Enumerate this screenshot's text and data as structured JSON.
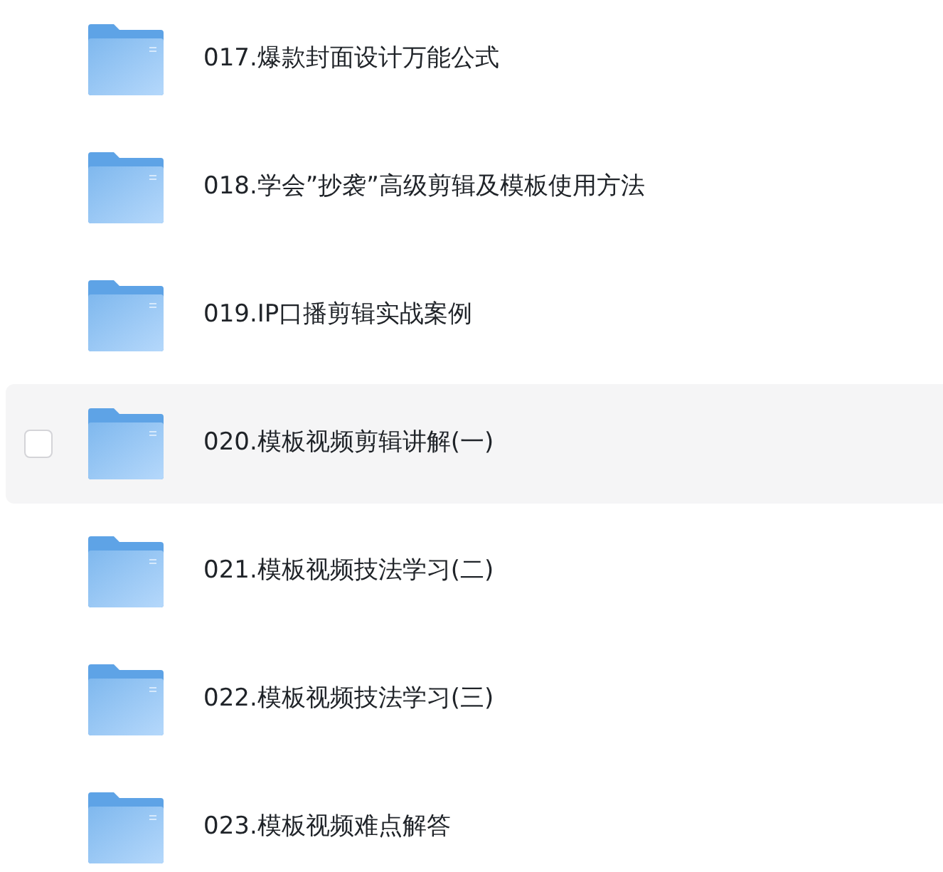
{
  "files": [
    {
      "name": "017.爆款封面设计万能公式",
      "highlighted": false,
      "checked": false
    },
    {
      "name": "018.学会”抄袭”高级剪辑及模板使用方法",
      "highlighted": false,
      "checked": false
    },
    {
      "name": "019.IP口播剪辑实战案例",
      "highlighted": false,
      "checked": false
    },
    {
      "name": "020.模板视频剪辑讲解(一)",
      "highlighted": true,
      "checked": false
    },
    {
      "name": "021.模板视频技法学习(二)",
      "highlighted": false,
      "checked": false
    },
    {
      "name": "022.模板视频技法学习(三)",
      "highlighted": false,
      "checked": false
    },
    {
      "name": "023.模板视频难点解答",
      "highlighted": false,
      "checked": false
    }
  ]
}
